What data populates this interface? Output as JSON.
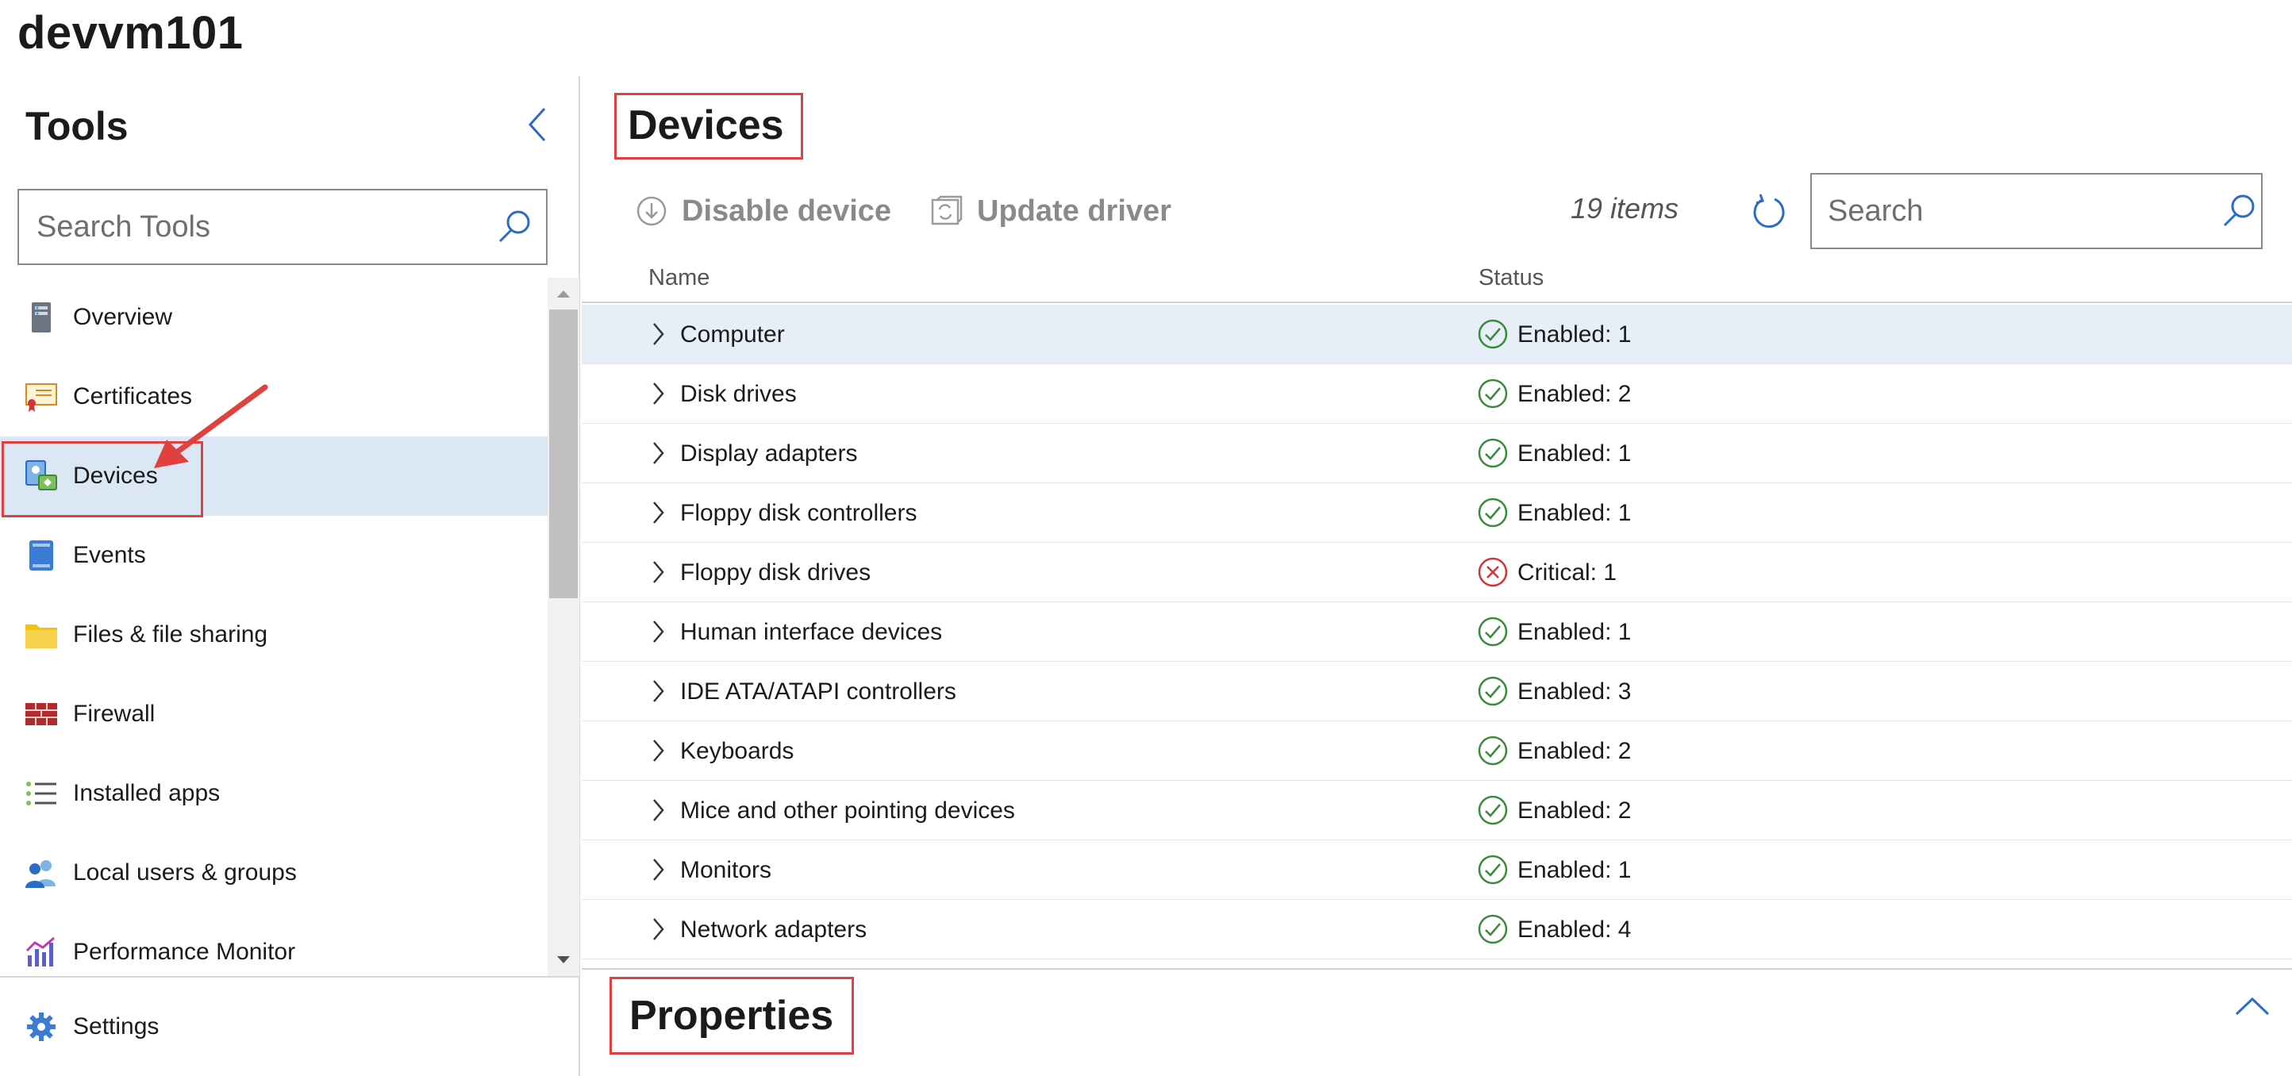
{
  "server": {
    "name": "devvm101"
  },
  "sidebar": {
    "title": "Tools",
    "search_placeholder": "Search Tools",
    "items": [
      {
        "label": "Overview",
        "icon": "server-icon"
      },
      {
        "label": "Certificates",
        "icon": "certificate-icon"
      },
      {
        "label": "Devices",
        "icon": "devices-icon",
        "selected": true
      },
      {
        "label": "Events",
        "icon": "events-log-icon"
      },
      {
        "label": "Files & file sharing",
        "icon": "folder-icon"
      },
      {
        "label": "Firewall",
        "icon": "firewall-icon"
      },
      {
        "label": "Installed apps",
        "icon": "list-icon"
      },
      {
        "label": "Local users & groups",
        "icon": "users-icon"
      },
      {
        "label": "Performance Monitor",
        "icon": "performance-chart-icon"
      }
    ],
    "settings_label": "Settings"
  },
  "main": {
    "title": "Devices",
    "toolbar": {
      "disable_label": "Disable device",
      "update_label": "Update driver",
      "items_count": "19 items",
      "search_placeholder": "Search"
    },
    "columns": {
      "name": "Name",
      "status": "Status"
    },
    "rows": [
      {
        "name": "Computer",
        "status": "Enabled: 1",
        "state": "ok"
      },
      {
        "name": "Disk drives",
        "status": "Enabled: 2",
        "state": "ok"
      },
      {
        "name": "Display adapters",
        "status": "Enabled: 1",
        "state": "ok"
      },
      {
        "name": "Floppy disk controllers",
        "status": "Enabled: 1",
        "state": "ok"
      },
      {
        "name": "Floppy disk drives",
        "status": "Critical: 1",
        "state": "critical"
      },
      {
        "name": "Human interface devices",
        "status": "Enabled: 1",
        "state": "ok"
      },
      {
        "name": "IDE ATA/ATAPI controllers",
        "status": "Enabled: 3",
        "state": "ok"
      },
      {
        "name": "Keyboards",
        "status": "Enabled: 2",
        "state": "ok"
      },
      {
        "name": "Mice and other pointing devices",
        "status": "Enabled: 2",
        "state": "ok"
      },
      {
        "name": "Monitors",
        "status": "Enabled: 1",
        "state": "ok"
      },
      {
        "name": "Network adapters",
        "status": "Enabled: 4",
        "state": "ok"
      }
    ],
    "properties_title": "Properties"
  },
  "colors": {
    "selected_bg": "#dce7f5",
    "row_highlight": "#e6eef8",
    "annotation": "#e0413f",
    "ok": "#3b8a3b",
    "critical": "#d13438",
    "accent": "#2b6cc4"
  }
}
